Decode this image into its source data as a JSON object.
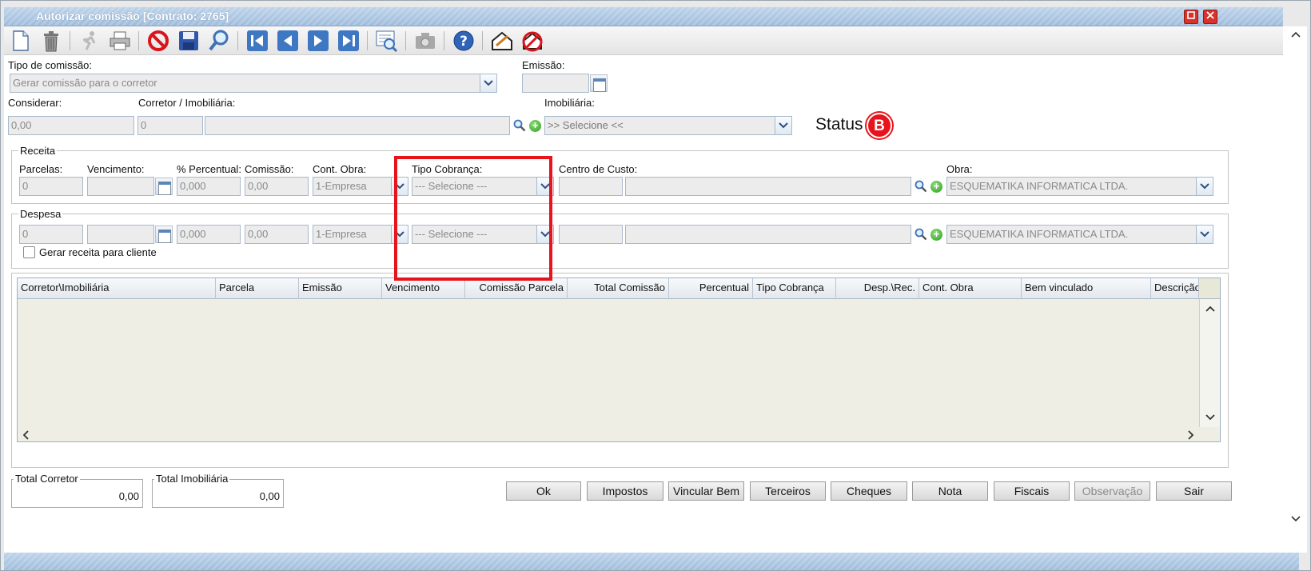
{
  "window": {
    "title": "Autorizar comissão [Contrato: 2765]"
  },
  "toolbar": {
    "icons": [
      "new-document-icon",
      "trash-icon",
      "run-icon",
      "printer-icon",
      "cancel-icon",
      "save-icon",
      "search-icon",
      "first-record-icon",
      "previous-record-icon",
      "next-record-icon",
      "last-record-icon",
      "report-icon",
      "camera-icon",
      "help-icon",
      "sign-icon",
      "unsign-icon"
    ]
  },
  "form": {
    "tipo_comissao": {
      "label": "Tipo de comissão:",
      "value": "Gerar comissão para o corretor"
    },
    "emissao": {
      "label": "Emissão:",
      "value": ""
    },
    "considerar": {
      "label": "Considerar:",
      "value": "0,00"
    },
    "corretor": {
      "label": "Corretor / Imobiliária:",
      "code": "0",
      "name": ""
    },
    "imobiliaria": {
      "label": "Imobiliária:",
      "value": ">> Selecione <<"
    },
    "status": {
      "label": "Status",
      "badge": "B"
    }
  },
  "receita": {
    "legend": "Receita",
    "labels": {
      "parcelas": "Parcelas:",
      "vencimento": "Vencimento:",
      "percentual": "% Percentual:",
      "comissao": "Comissão:",
      "cont_obra": "Cont. Obra:",
      "tipo_cobranca": "Tipo Cobrança:",
      "centro_custo": "Centro de Custo:",
      "obra": "Obra:"
    },
    "parcelas": "0",
    "vencimento": "",
    "percentual": "0,000",
    "comissao": "0,00",
    "cont_obra": "1-Empresa",
    "tipo_cobranca": "--- Selecione ---",
    "centro_custo_code": "",
    "centro_custo_name": "",
    "obra": "ESQUEMATIKA INFORMATICA LTDA."
  },
  "despesa": {
    "legend": "Despesa",
    "parcelas": "0",
    "vencimento": "",
    "percentual": "0,000",
    "comissao": "0,00",
    "cont_obra": "1-Empresa",
    "tipo_cobranca": "--- Selecione ---",
    "centro_custo_code": "",
    "centro_custo_name": "",
    "obra": "ESQUEMATIKA INFORMATICA LTDA.",
    "gerar_receita_label": "Gerar receita para cliente"
  },
  "grid": {
    "columns": [
      "Corretor\\Imobiliária",
      "Parcela",
      "Emissão",
      "Vencimento",
      "Comissão Parcela",
      "Total Comissão",
      "Percentual",
      "Tipo Cobrança",
      "Desp.\\Rec.",
      "Cont. Obra",
      "Bem vinculado",
      "Descrição"
    ],
    "rows": []
  },
  "totals": {
    "corretor": {
      "label": "Total Corretor",
      "value": "0,00"
    },
    "imobiliaria": {
      "label": "Total Imobiliária",
      "value": "0,00"
    }
  },
  "buttons": {
    "ok": "Ok",
    "impostos": "Impostos",
    "vincular_bem": "Vincular Bem",
    "terceiros": "Terceiros",
    "cheques": "Cheques",
    "nota": "Nota",
    "fiscais": "Fiscais",
    "observacao": "Observação",
    "sair": "Sair"
  },
  "colors": {
    "highlight": "#e8141c",
    "status_badge": "#e8141c",
    "title_bar": "#a6c2df"
  }
}
